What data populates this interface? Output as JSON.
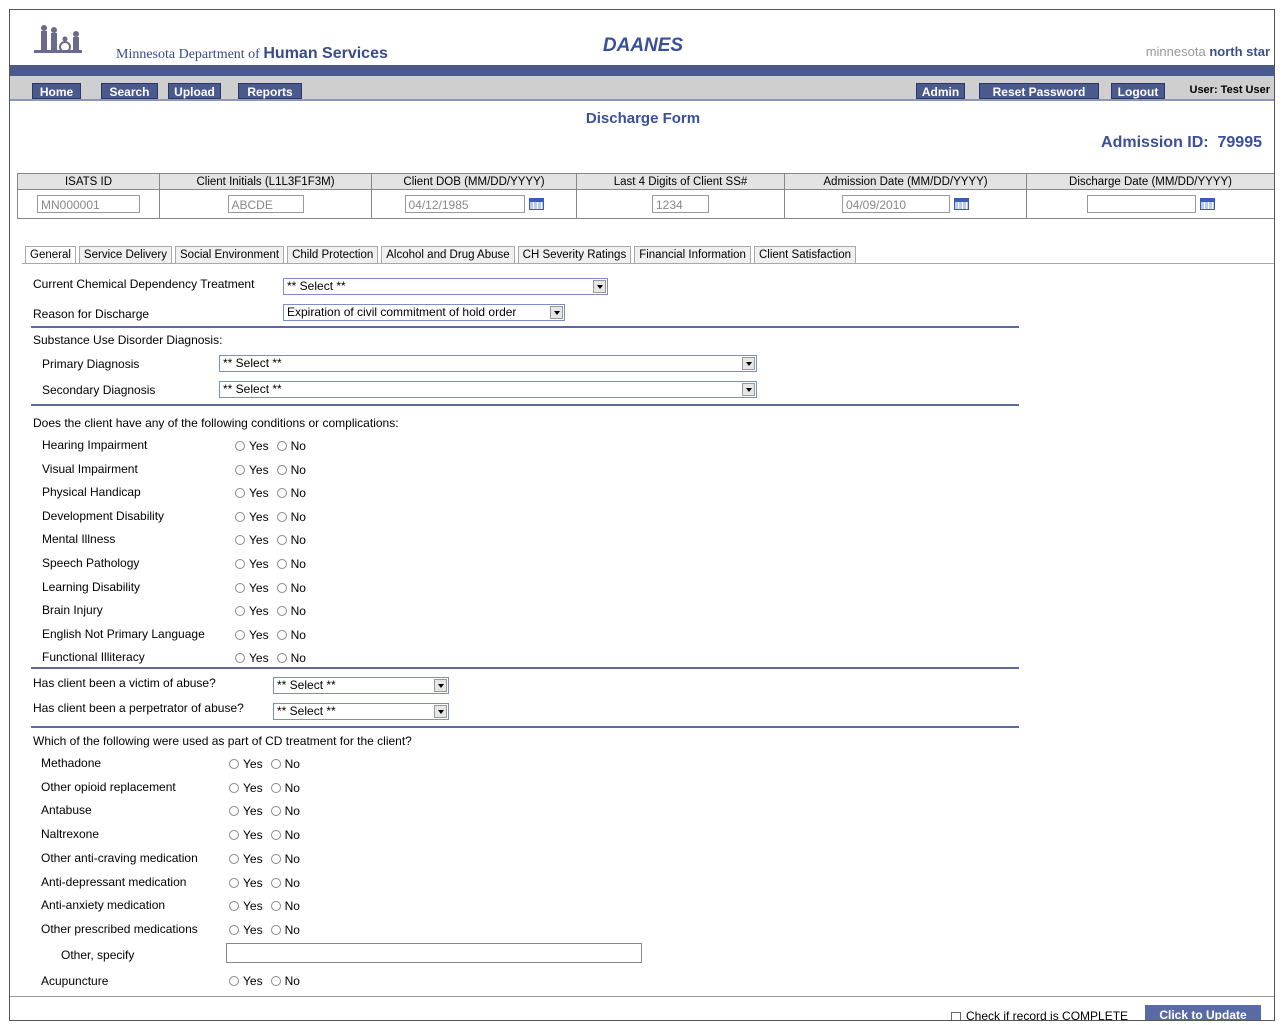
{
  "header": {
    "dept_prefix": "Minnesota Department of",
    "dept_bold": "Human Services",
    "app_title": "DAANES",
    "northstar_prefix": "minnesota",
    "northstar_bold": "north star"
  },
  "nav": {
    "left": [
      "Home",
      "Search",
      "Upload",
      "Reports"
    ],
    "admin": "Admin",
    "reset": "Reset Password",
    "logout": "Logout",
    "user": "User: Test User"
  },
  "form": {
    "title": "Discharge Form",
    "admission_id_label": "Admission ID:",
    "admission_id": "79995"
  },
  "ids": {
    "headers": [
      "ISATS ID",
      "Client Initials (L1L3F1F3M)",
      "Client DOB (MM/DD/YYYY)",
      "Last 4 Digits of Client SS#",
      "Admission Date (MM/DD/YYYY)",
      "Discharge Date (MM/DD/YYYY)"
    ],
    "values": [
      "MN000001",
      "ABCDE",
      "04/12/1985",
      "1234",
      "04/09/2010",
      ""
    ]
  },
  "tabs": [
    "General",
    "Service Delivery",
    "Social Environment",
    "Child Protection",
    "Alcohol and Drug Abuse",
    "CH Severity Ratings",
    "Financial Information",
    "Client Satisfaction"
  ],
  "general": {
    "treatment_label": "Current Chemical Dependency Treatment",
    "treatment_value": "** Select **",
    "reason_label": "Reason for Discharge",
    "reason_value": "Expiration of civil commitment of hold order",
    "diag_heading": "Substance Use Disorder Diagnosis:",
    "primary_label": "Primary Diagnosis",
    "primary_value": "** Select **",
    "secondary_label": "Secondary Diagnosis",
    "secondary_value": "** Select **",
    "conditions_heading": "Does the client have any of the following conditions or complications:",
    "conditions": [
      "Hearing Impairment",
      "Visual Impairment",
      "Physical Handicap",
      "Development Disability",
      "Mental Illness",
      "Speech Pathology",
      "Learning Disability",
      "Brain Injury",
      "English Not Primary Language",
      "Functional Illiteracy"
    ],
    "yes": "Yes",
    "no": "No",
    "victim_label": "Has client been a victim of abuse?",
    "victim_value": "** Select **",
    "perp_label": "Has client been a perpetrator of abuse?",
    "perp_value": "** Select **",
    "cd_heading": "Which of the following were used as part of CD treatment for the client?",
    "cd_items": [
      "Methadone",
      "Other opioid replacement",
      "Antabuse",
      "Naltrexone",
      "Other anti-craving medication",
      "Anti-depressant medication",
      "Anti-anxiety medication",
      "Other prescribed medications"
    ],
    "other_specify_label": "Other, specify",
    "acupuncture_label": "Acupuncture"
  },
  "footer": {
    "complete_label": "Check if record is COMPLETE",
    "update_label": "Click to Update"
  }
}
